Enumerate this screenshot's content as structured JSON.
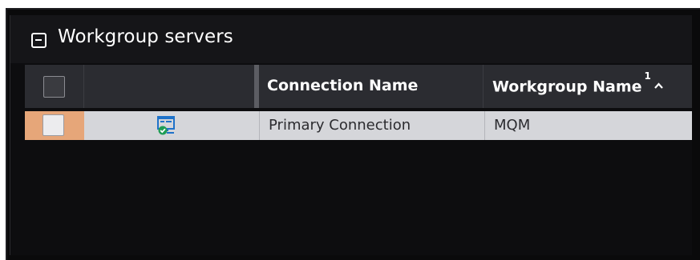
{
  "panel": {
    "title": "Workgroup servers",
    "collapse_icon": "minus-square-icon"
  },
  "table": {
    "columns": [
      {
        "label": ""
      },
      {
        "label": ""
      },
      {
        "label": "Connection Name"
      },
      {
        "label": "Workgroup Name",
        "sort_order": "1",
        "sort_direction": "ascending",
        "sort_indicator": "^"
      }
    ],
    "rows": [
      {
        "selected": false,
        "status_icon": "connected-server-icon",
        "connection_name": "Primary Connection",
        "workgroup_name": "MQM"
      }
    ]
  },
  "colors": {
    "background": "#0a0a0b",
    "header": "#2b2c31",
    "row": "#d5d6da",
    "row_accent": "#e6a679",
    "icon_blue": "#1f72c9",
    "icon_green": "#1f9d55"
  }
}
